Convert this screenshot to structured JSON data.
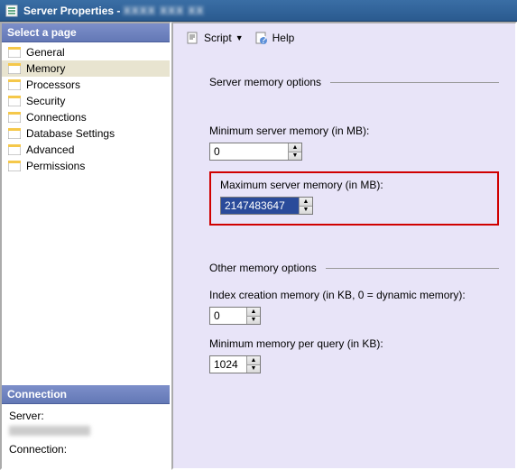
{
  "window": {
    "title": "Server Properties - "
  },
  "sidebar": {
    "header": "Select a page",
    "items": [
      {
        "label": "General"
      },
      {
        "label": "Memory"
      },
      {
        "label": "Processors"
      },
      {
        "label": "Security"
      },
      {
        "label": "Connections"
      },
      {
        "label": "Database Settings"
      },
      {
        "label": "Advanced"
      },
      {
        "label": "Permissions"
      }
    ],
    "connection_header": "Connection",
    "server_label": "Server:",
    "connection_label": "Connection:"
  },
  "toolbar": {
    "script": "Script",
    "help": "Help"
  },
  "main": {
    "section1": "Server memory options",
    "min_label": "Minimum server memory (in MB):",
    "min_value": "0",
    "max_label": "Maximum server memory (in MB):",
    "max_value": "2147483647",
    "section2": "Other memory options",
    "index_label": "Index creation memory (in KB, 0 = dynamic memory):",
    "index_value": "0",
    "query_label": "Minimum memory per query (in KB):",
    "query_value": "1024"
  }
}
